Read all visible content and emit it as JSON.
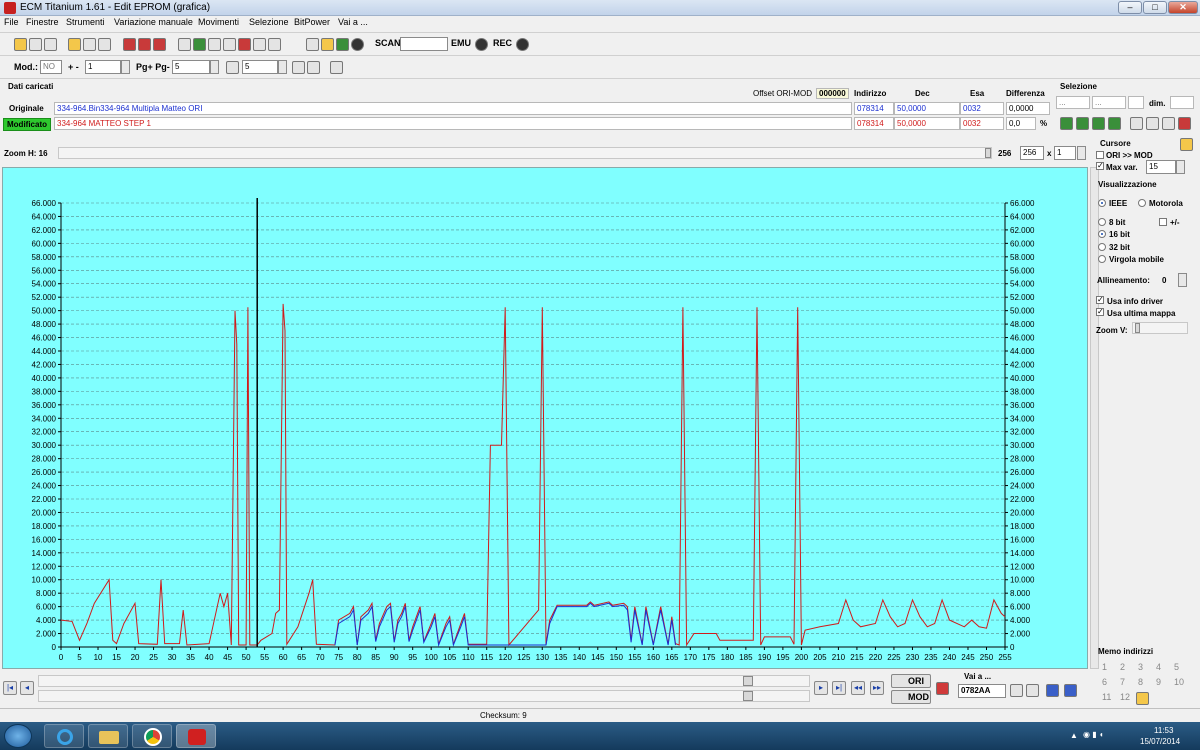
{
  "window": {
    "title": "ECM Titanium 1.61 - Edit EPROM (grafica)"
  },
  "menu": [
    "File",
    "Finestre",
    "Strumenti",
    "Variazione manuale",
    "Movimenti",
    "Selezione",
    "BitPower",
    "Vai a ..."
  ],
  "toolbar1": {
    "scan": "SCAN",
    "emu": "EMU",
    "rec": "REC"
  },
  "toolbar2": {
    "mod_label": "Mod.:",
    "mod_value": "NO",
    "plusminus": "+ -",
    "step_value": "1",
    "pg_label": "Pg+ Pg-",
    "pg_value": "5",
    "p_value": "5"
  },
  "info": {
    "title": "Dati caricati",
    "offset_label": "Offset ORI-MOD",
    "offset_value": "000000",
    "headers": {
      "indirizzo": "Indirizzo",
      "dec": "Dec",
      "esa": "Esa",
      "differenza": "Differenza"
    },
    "original": {
      "label": "Originale",
      "file": "334-964.Bin334-964 Multipla Matteo ORI",
      "indirizzo": "078314",
      "dec": "50,0000",
      "esa": "0032",
      "diff": "0,0000"
    },
    "modified": {
      "label": "Modificato",
      "file": "334-964 MATTEO STEP 1",
      "indirizzo": "078314",
      "dec": "50,0000",
      "esa": "0032",
      "diff": "0,0",
      "pct": "%"
    },
    "selezione": {
      "title": "Selezione",
      "f1": "...",
      "f2": "...",
      "dim": "dim."
    }
  },
  "zoom": {
    "label": "Zoom H: 16",
    "v1": "256",
    "v2": "256",
    "x": "x",
    "v3": "1"
  },
  "cursor": {
    "title": "Cursore",
    "ori_mod": "ORI >> MOD",
    "maxvar": "Max var.",
    "maxvar_value": "15"
  },
  "visual": {
    "title": "Visualizzazione",
    "ieee": "IEEE",
    "motorola": "Motorola",
    "b8": "8 bit",
    "pm": "+/-",
    "b16": "16 bit",
    "b32": "32 bit",
    "float": "Virgola mobile",
    "align": "Allineamento:",
    "align_value": "0",
    "info_driver": "Usa info driver",
    "last_map": "Usa ultima mappa",
    "zoomv": "Zoom V:"
  },
  "memo": {
    "title": "Memo indirizzi",
    "items": [
      "1",
      "2",
      "3",
      "4",
      "5",
      "6",
      "7",
      "8",
      "9",
      "10",
      "11",
      "12"
    ]
  },
  "bottom": {
    "ori": "ORI",
    "mod": "MOD",
    "goto_title": "Vai a ...",
    "goto_value": "0782AA"
  },
  "status": {
    "checksum": "Checksum: 9"
  },
  "clock": {
    "time": "11:53",
    "date": "15/07/2014"
  },
  "colors": {
    "original": "#1b2fd0",
    "modified": "#d01b1b",
    "chart_bg": "#80ffff"
  },
  "chart_data": {
    "type": "line",
    "xlim": [
      0,
      255
    ],
    "ylim": [
      0,
      66000
    ],
    "y_ticks": [
      "0",
      "2.000",
      "4.000",
      "6.000",
      "8.000",
      "10.000",
      "12.000",
      "14.000",
      "16.000",
      "18.000",
      "20.000",
      "22.000",
      "24.000",
      "26.000",
      "28.000",
      "30.000",
      "32.000",
      "34.000",
      "36.000",
      "38.000",
      "40.000",
      "42.000",
      "44.000",
      "46.000",
      "48.000",
      "50.000",
      "52.000",
      "54.000",
      "56.000",
      "58.000",
      "60.000",
      "62.000",
      "64.000",
      "66.000"
    ],
    "x_ticks": [
      "0",
      "5",
      "10",
      "15",
      "20",
      "25",
      "30",
      "35",
      "40",
      "45",
      "50",
      "55",
      "60",
      "65",
      "70",
      "75",
      "80",
      "85",
      "90",
      "95",
      "100",
      "105",
      "110",
      "115",
      "120",
      "125",
      "130",
      "135",
      "140",
      "145",
      "150",
      "155",
      "160",
      "165",
      "170",
      "175",
      "180",
      "185",
      "190",
      "195",
      "200",
      "205",
      "210",
      "215",
      "220",
      "225",
      "230",
      "235",
      "240",
      "245",
      "250",
      "255"
    ],
    "cursor_x": 53,
    "grid": true,
    "series": [
      {
        "color": "#d01b1b",
        "points": [
          [
            0,
            4000
          ],
          [
            3,
            3800
          ],
          [
            5,
            1000
          ],
          [
            7,
            3500
          ],
          [
            9,
            6500
          ],
          [
            13,
            10000
          ],
          [
            14,
            1000
          ],
          [
            15,
            500
          ],
          [
            17,
            3500
          ],
          [
            20,
            6500
          ],
          [
            21,
            500
          ],
          [
            26,
            400
          ],
          [
            27,
            10000
          ],
          [
            28,
            500
          ],
          [
            32,
            500
          ],
          [
            33,
            5500
          ],
          [
            34,
            300
          ],
          [
            40,
            500
          ],
          [
            41,
            3000
          ],
          [
            43,
            8000
          ],
          [
            44,
            6000
          ],
          [
            45,
            8000
          ],
          [
            46,
            300
          ],
          [
            47,
            50000
          ],
          [
            47.5,
            45000
          ],
          [
            48,
            300
          ],
          [
            50,
            300
          ],
          [
            50.5,
            50500
          ],
          [
            51,
            300
          ],
          [
            53,
            300
          ],
          [
            54,
            1000
          ],
          [
            57,
            2000
          ],
          [
            58,
            5000
          ],
          [
            59,
            5500
          ],
          [
            60,
            51000
          ],
          [
            60.5,
            47000
          ],
          [
            61,
            400
          ],
          [
            64,
            3000
          ],
          [
            67,
            8000
          ],
          [
            68,
            10000
          ],
          [
            69,
            400
          ],
          [
            74,
            300
          ],
          [
            75,
            4000
          ],
          [
            78,
            5000
          ],
          [
            79,
            6000
          ],
          [
            80,
            300
          ],
          [
            81,
            4500
          ],
          [
            83,
            5500
          ],
          [
            84,
            6500
          ],
          [
            85,
            1000
          ],
          [
            86,
            3500
          ],
          [
            88,
            6000
          ],
          [
            89,
            6500
          ],
          [
            90,
            800
          ],
          [
            91,
            4000
          ],
          [
            92,
            5000
          ],
          [
            93,
            6500
          ],
          [
            94,
            1000
          ],
          [
            95,
            3000
          ],
          [
            97,
            6000
          ],
          [
            98,
            800
          ],
          [
            100,
            3500
          ],
          [
            101,
            5000
          ],
          [
            102,
            400
          ],
          [
            104,
            3500
          ],
          [
            105,
            4500
          ],
          [
            106,
            400
          ],
          [
            108,
            3500
          ],
          [
            109,
            5000
          ],
          [
            110,
            400
          ],
          [
            115,
            400
          ],
          [
            116,
            30000
          ],
          [
            119,
            30000
          ],
          [
            120,
            50500
          ],
          [
            121,
            300
          ],
          [
            129,
            5500
          ],
          [
            130,
            50500
          ],
          [
            131,
            300
          ],
          [
            132,
            4000
          ],
          [
            134,
            6200
          ],
          [
            142,
            6200
          ],
          [
            143,
            6700
          ],
          [
            144,
            6200
          ],
          [
            148,
            6700
          ],
          [
            149,
            6200
          ],
          [
            152,
            6500
          ],
          [
            153,
            6000
          ],
          [
            154,
            1000
          ],
          [
            155,
            6000
          ],
          [
            157,
            400
          ],
          [
            158,
            6000
          ],
          [
            160,
            400
          ],
          [
            162,
            6000
          ],
          [
            164,
            400
          ],
          [
            165,
            4500
          ],
          [
            166,
            500
          ],
          [
            167,
            300
          ],
          [
            168,
            50500
          ],
          [
            169,
            300
          ],
          [
            171,
            2000
          ],
          [
            177,
            2000
          ],
          [
            178,
            1000
          ],
          [
            187,
            1000
          ],
          [
            188,
            50500
          ],
          [
            189,
            300
          ],
          [
            190,
            1500
          ],
          [
            197,
            1500
          ],
          [
            198,
            400
          ],
          [
            199,
            50500
          ],
          [
            200,
            300
          ],
          [
            201,
            2500
          ],
          [
            205,
            3000
          ],
          [
            210,
            3500
          ],
          [
            212,
            7000
          ],
          [
            214,
            4000
          ],
          [
            216,
            3000
          ],
          [
            220,
            3500
          ],
          [
            222,
            7000
          ],
          [
            224,
            4500
          ],
          [
            226,
            3000
          ],
          [
            228,
            3500
          ],
          [
            230,
            7000
          ],
          [
            232,
            4500
          ],
          [
            234,
            3000
          ],
          [
            236,
            3500
          ],
          [
            238,
            7000
          ],
          [
            240,
            4000
          ],
          [
            244,
            3000
          ],
          [
            246,
            4000
          ],
          [
            248,
            3000
          ],
          [
            250,
            2800
          ],
          [
            252,
            7000
          ],
          [
            254,
            5000
          ],
          [
            255,
            4500
          ]
        ]
      },
      {
        "color": "#1b2fd0",
        "points": [
          [
            74,
            300
          ],
          [
            75,
            3500
          ],
          [
            78,
            4500
          ],
          [
            79,
            5500
          ],
          [
            80,
            300
          ],
          [
            81,
            4000
          ],
          [
            83,
            5000
          ],
          [
            84,
            6000
          ],
          [
            85,
            800
          ],
          [
            86,
            3000
          ],
          [
            88,
            5500
          ],
          [
            89,
            6000
          ],
          [
            90,
            700
          ],
          [
            91,
            3500
          ],
          [
            92,
            4500
          ],
          [
            93,
            6000
          ],
          [
            94,
            800
          ],
          [
            95,
            2500
          ],
          [
            97,
            5500
          ],
          [
            98,
            700
          ],
          [
            100,
            3000
          ],
          [
            101,
            4500
          ],
          [
            102,
            300
          ],
          [
            104,
            3000
          ],
          [
            105,
            4000
          ],
          [
            106,
            300
          ],
          [
            108,
            3000
          ],
          [
            109,
            4500
          ],
          [
            110,
            300
          ],
          [
            131,
            300
          ],
          [
            132,
            3500
          ],
          [
            134,
            6000
          ],
          [
            142,
            6000
          ],
          [
            143,
            6500
          ],
          [
            144,
            6000
          ],
          [
            148,
            6500
          ],
          [
            149,
            6000
          ],
          [
            152,
            6200
          ],
          [
            153,
            5500
          ],
          [
            154,
            700
          ],
          [
            155,
            5500
          ],
          [
            157,
            300
          ],
          [
            158,
            5500
          ],
          [
            160,
            300
          ],
          [
            162,
            5500
          ],
          [
            164,
            300
          ],
          [
            165,
            4000
          ],
          [
            166,
            300
          ]
        ]
      }
    ]
  }
}
